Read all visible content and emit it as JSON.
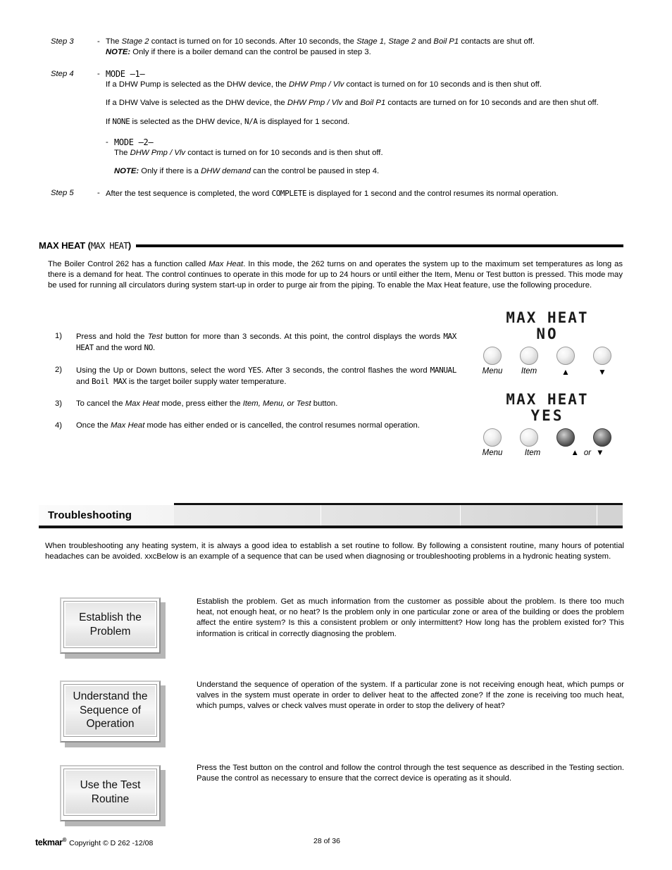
{
  "document": {
    "steps": [
      {
        "label": "Step 3",
        "dash": "-",
        "lines": [
          "The <i>Stage 2</i> contact is turned on for 10 seconds. After 10 seconds, the <i>Stage 1, Stage 2</i> and <i>Boil P1</i> contacts are shut off.",
          "<b><i>NOTE:</i></b> Only if there is a boiler demand can the control be paused in step 3."
        ]
      }
    ],
    "step4": {
      "label": "Step 4",
      "dash": "-",
      "mode1_title": "MODE —1—",
      "mode1_p1": "If a DHW Pump is selected as the DHW device, the <i>DHW Pmp / Vlv</i> contact is turned on for 10 seconds and is then shut off.",
      "mode1_p2": "If a DHW Valve is selected as the DHW device, the <i>DHW Pmp / Vlv</i> and <i>Boil P1</i> contacts are turned on for 10 seconds and are then shut off.",
      "mode1_p3_a": "If ",
      "mode1_p3_none": "NONE",
      "mode1_p3_b": " is selected as the DHW device, ",
      "mode1_p3_na": "N/A",
      "mode1_p3_c": " is displayed for 1 second.",
      "mode2_title": "MODE —2—",
      "mode2_p1": "The <i>DHW Pmp / Vlv</i> contact is turned on for 10 seconds and is then shut off.",
      "mode2_note": "<b><i>NOTE:</i></b> Only if there is a <i>DHW demand</i> can the control be paused in step 4."
    },
    "step5": {
      "label": "Step 5",
      "dash": "-",
      "text_a": "After the test sequence is completed, the word ",
      "text_mono": "COMPLETE",
      "text_b": " is displayed for 1 second and the control resumes its normal operation."
    },
    "max_heat_section": {
      "heading_bold": "MAX HEAT (",
      "heading_mono": "MAX HEAT",
      "heading_close": ")",
      "paragraph": "The Boiler Control 262 has a function called <i>Max Heat</i>. In this mode, the 262 turns on and operates the system up to the maximum set temperatures as long as there is a demand for heat. The control continues to operate in this mode for up to 24 hours or until either the Item, Menu or Test button is pressed. This mode may be used for running all circulators during system start-up in order to purge air from the piping. To enable the Max Heat feature, use the following procedure.",
      "items": [
        {
          "number": "1)",
          "html": "Press and hold the <i>Test</i> button for more than 3 seconds. At this point, the control displays the words <span class='lcd'>MAX HEAT</span> and the word <span class='lcd'>NO</span>."
        },
        {
          "number": "2)",
          "html": "Using the Up or Down buttons, select the word <span class='lcd'>YES</span>. After 3 seconds, the control flashes the word <span class='lcd'>MANUAL</span> and <span class='lcd'>Boil MAX</span> is the target boiler supply water temperature."
        },
        {
          "number": "3)",
          "html": "To cancel the <i>Max Heat</i> mode, press either the <i>Item, Menu, or Test</i> button."
        },
        {
          "number": "4)",
          "html": "Once the <i>Max Heat</i> mode has either ended or is cancelled, the control resumes normal operation."
        }
      ]
    },
    "panels": [
      {
        "lcd_line1": "MAX HEAT",
        "lcd_line2": "NO",
        "buttons": [
          {
            "label": "Menu",
            "state": "light",
            "icon": "menu-button"
          },
          {
            "label": "Item",
            "state": "light",
            "icon": "item-button"
          },
          {
            "label": "▲",
            "state": "light",
            "icon": "up-arrow-button"
          },
          {
            "label": "▼",
            "state": "light",
            "icon": "down-arrow-button"
          }
        ],
        "or_label": ""
      },
      {
        "lcd_line1": "MAX HEAT",
        "lcd_line2": "YES",
        "buttons": [
          {
            "label": "Menu",
            "state": "light",
            "icon": "menu-button"
          },
          {
            "label": "Item",
            "state": "light",
            "icon": "item-button"
          },
          {
            "label": "▲",
            "state": "dark",
            "icon": "up-arrow-button"
          },
          {
            "label": "▼",
            "state": "dark",
            "icon": "down-arrow-button"
          }
        ],
        "or_label": "or"
      }
    ],
    "troubleshooting": {
      "banner_title": "Troubleshooting",
      "intro": "When troubleshooting any heating system, it is always a good idea to establish a set routine to follow. By following a consistent routine, many hours of potential headaches can be avoided. xxcBelow is an example of a sequence that can be used when diagnosing or troubleshooting problems in a hydronic heating system.",
      "flow": [
        {
          "box_label": "Establish the Problem",
          "text": "Establish the problem. Get as much information from the customer as possible about the problem. Is there too much heat, not enough heat, or no heat? Is the problem only in one particular zone or area of the building or does the problem affect the entire system? Is this a consistent problem or only intermittent? How long has the problem existed for? This information is critical in correctly diagnosing the problem."
        },
        {
          "box_label": "Understand the Sequence of Operation",
          "text": "Understand the sequence of operation of the system. If a particular zone is not receiving enough heat, which pumps or valves in the system must operate in order to deliver heat to the affected zone? If the zone is receiving too much heat, which pumps, valves or check valves must operate in order to stop the delivery of heat?"
        },
        {
          "box_label": "Use the Test Routine",
          "text": "Press the Test button on the control and follow the control through the test sequence as described in the Testing section. Pause the control as necessary to ensure that the correct device is operating as it should."
        }
      ]
    },
    "footer": {
      "brand": "tekmar",
      "brand_sup": "®",
      "copyright": "Copyright © D 262 -12/08",
      "page": "28 of 36"
    }
  }
}
